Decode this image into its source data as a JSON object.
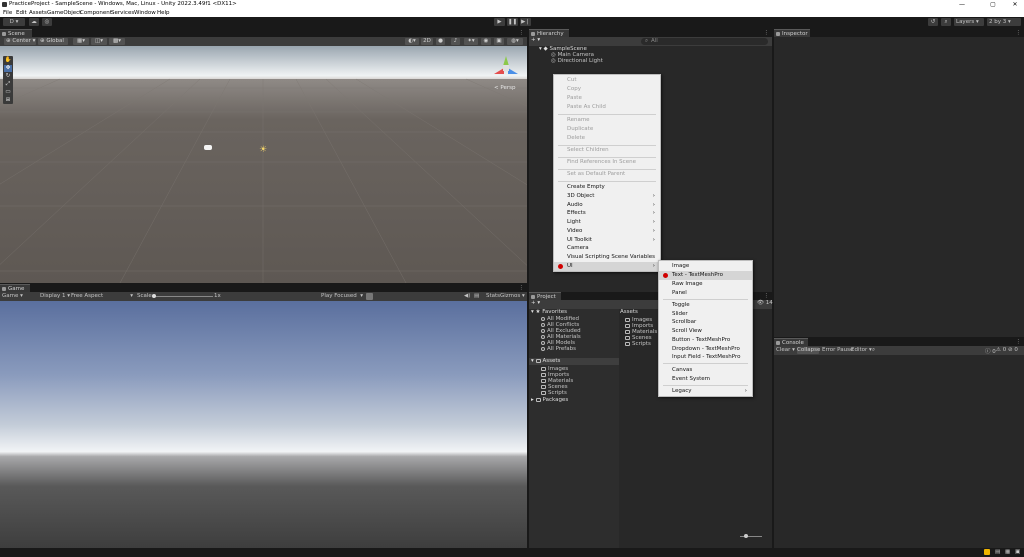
{
  "window": {
    "title": "PracticeProject - SampleScene - Windows, Mac, Linux - Unity 2022.3.49f1 <DX11>",
    "controls": {
      "minimize": "—",
      "maximize": "▢",
      "close": "✕"
    }
  },
  "menubar": [
    "File",
    "Edit",
    "Assets",
    "GameObject",
    "Component",
    "Services",
    "Window",
    "Help"
  ],
  "toolbar": {
    "account": "D",
    "play": "▶",
    "pause": "❚❚",
    "step": "▶❘",
    "layers": "Layers",
    "layout": "2 by 3"
  },
  "scene": {
    "tab": "Scene",
    "pivot": "Center",
    "space": "Global",
    "mode_2d": "2D",
    "persp": "< Persp",
    "colors": {
      "sky_top": "#9aa6b0",
      "horizon": "#f0f3f4",
      "ground": "#625c57"
    }
  },
  "game": {
    "tab": "Game",
    "mode": "Game",
    "display": "Display 1",
    "aspect": "Free Aspect",
    "scale_label": "Scale",
    "scale_value": "1x",
    "play_focused": "Play Focused",
    "stats": "Stats",
    "gizmos": "Gizmos"
  },
  "hierarchy": {
    "tab": "Hierarchy",
    "search_placeholder": "All",
    "scene_name": "SampleScene",
    "items": [
      "Main Camera",
      "Directional Light"
    ]
  },
  "inspector": {
    "tab": "Inspector"
  },
  "project": {
    "tab": "Project",
    "count": "14",
    "favorites_label": "Favorites",
    "favorites": [
      "All Modified",
      "All Conflicts",
      "All Excluded",
      "All Materials",
      "All Models",
      "All Prefabs"
    ],
    "assets_label": "Assets",
    "asset_folders": [
      "Images",
      "Imports",
      "Materials",
      "Scenes",
      "Scripts"
    ],
    "packages_label": "Packages",
    "grid_header": "Assets",
    "grid_items": [
      "Images",
      "Imports",
      "Materials",
      "Scenes",
      "Scripts"
    ]
  },
  "console": {
    "tab": "Console",
    "clear": "Clear",
    "collapse": "Collapse",
    "error_pause": "Error Pause",
    "editor": "Editor",
    "counts": [
      "0",
      "0",
      "0"
    ]
  },
  "context_menu": {
    "items": [
      "Cut",
      "Copy",
      "Paste",
      "Paste As Child",
      "Rename",
      "Duplicate",
      "Delete",
      "Select Children",
      "Find References In Scene",
      "Set as Default Parent",
      "Create Empty",
      "3D Object",
      "Audio",
      "Effects",
      "Light",
      "Video",
      "UI Toolkit",
      "Camera",
      "Visual Scripting Scene Variables",
      "UI"
    ]
  },
  "ui_submenu": {
    "items": [
      "Image",
      "Text - TextMeshPro",
      "Raw Image",
      "Panel",
      "Toggle",
      "Slider",
      "Scrollbar",
      "Scroll View",
      "Button - TextMeshPro",
      "Dropdown - TextMeshPro",
      "Input Field - TextMeshPro",
      "Canvas",
      "Event System",
      "Legacy"
    ]
  },
  "arrow": "›",
  "accent": "#d10000"
}
